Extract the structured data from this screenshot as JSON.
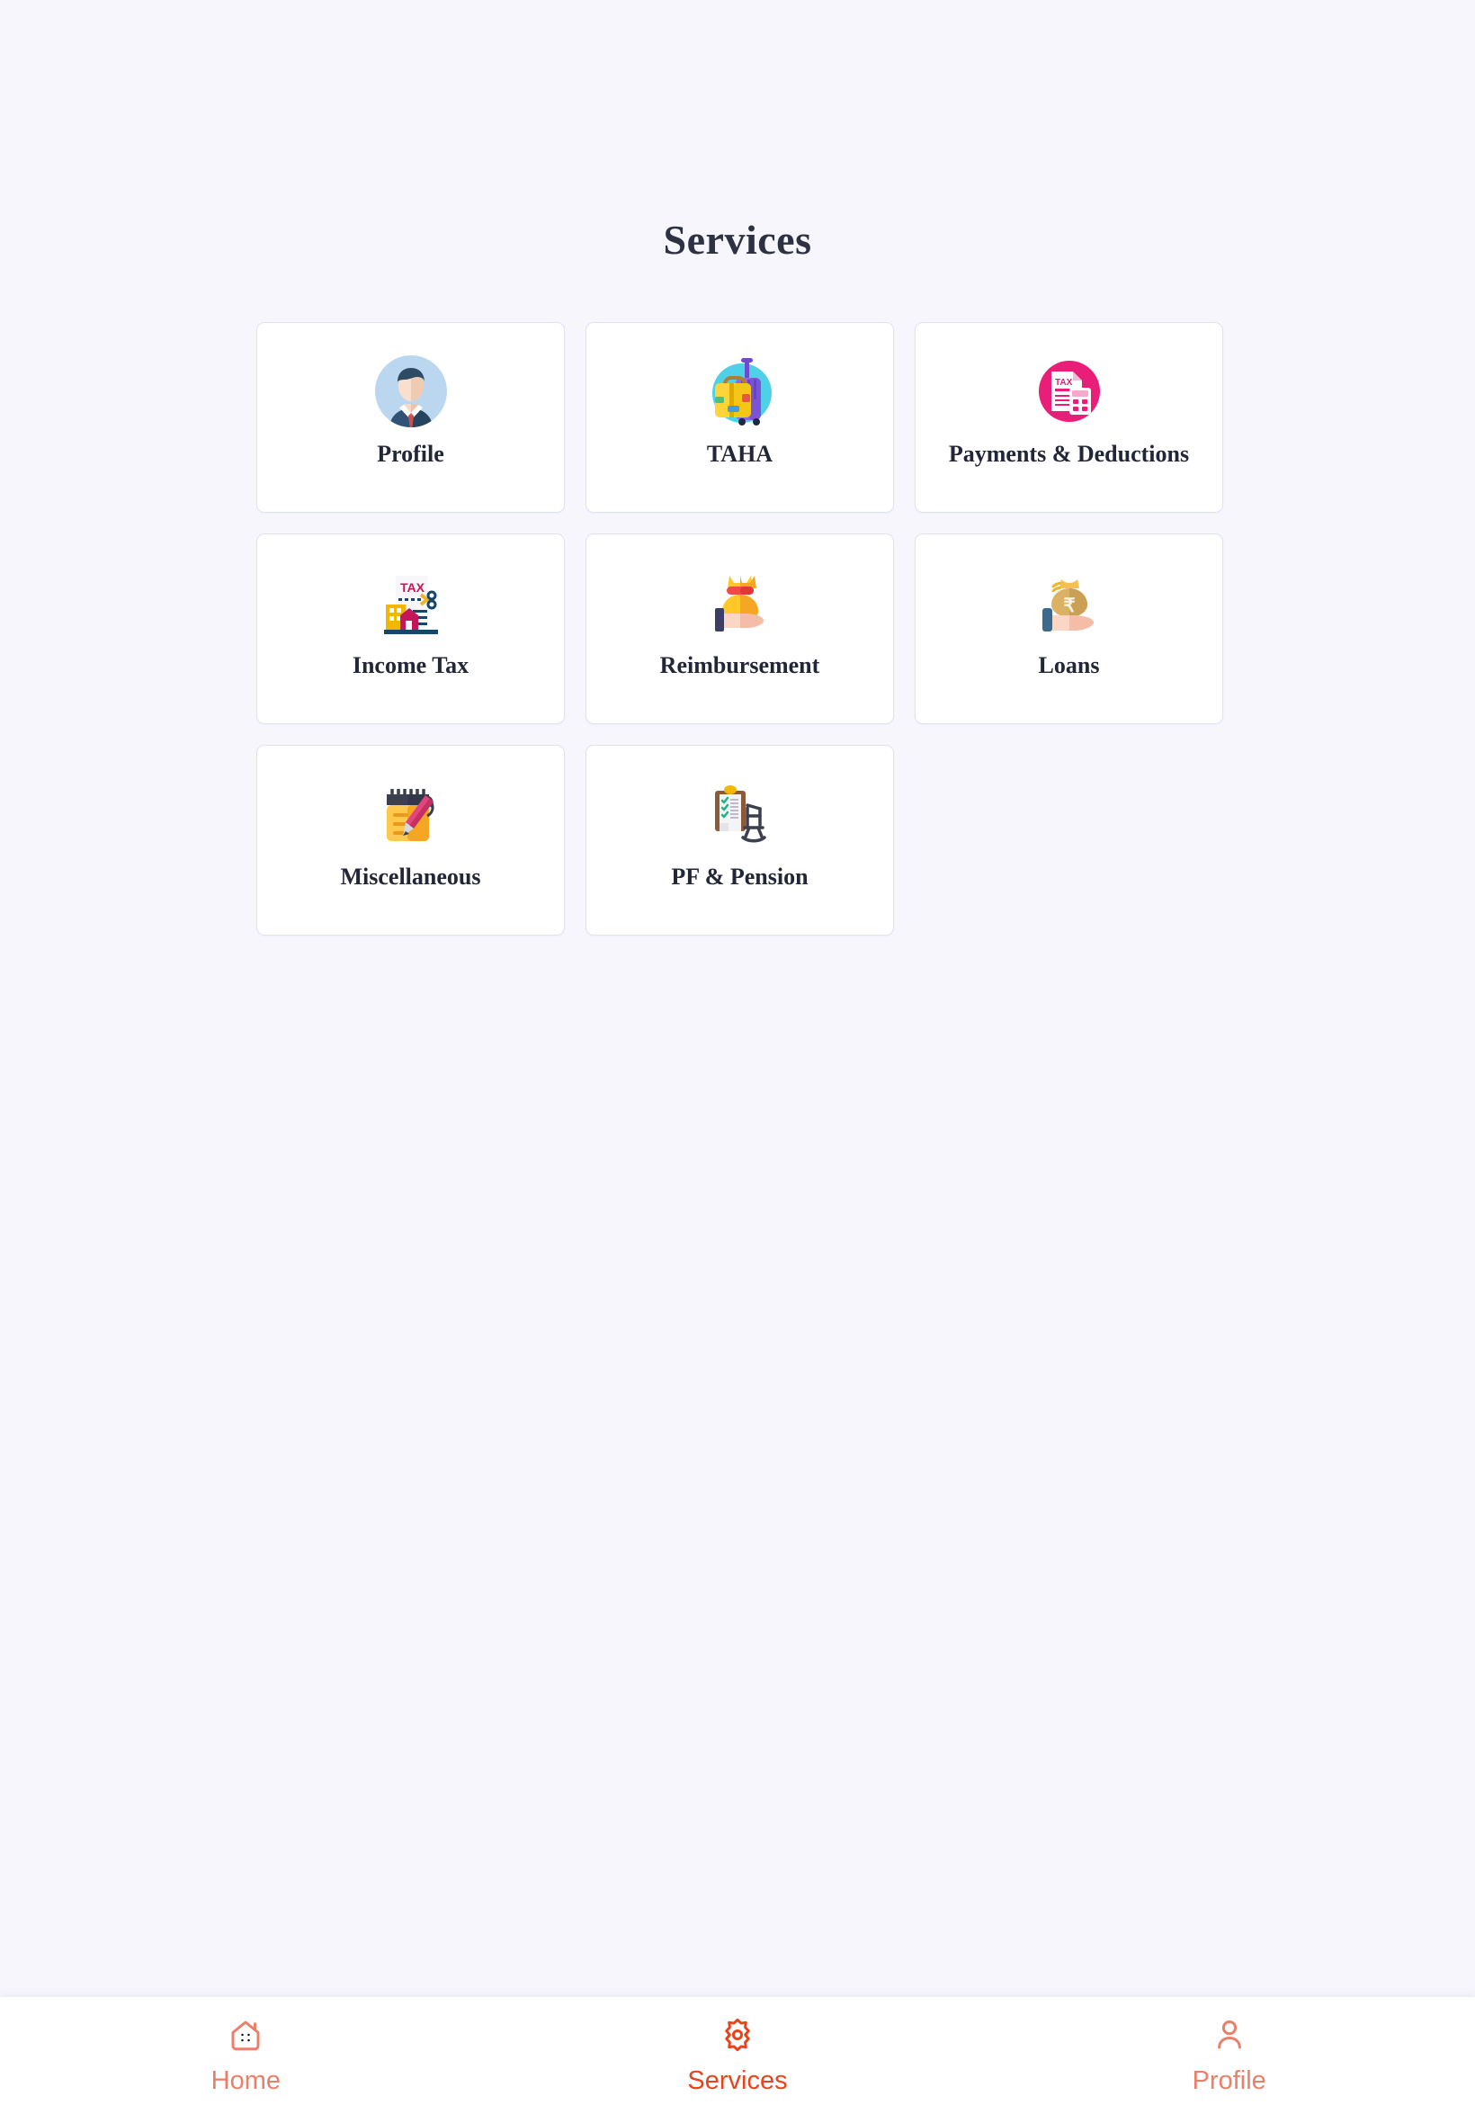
{
  "page": {
    "title": "Services",
    "background_color": "#f6f6fc"
  },
  "services": {
    "cards": [
      {
        "label": "Profile",
        "icon": "businessman-avatar-icon",
        "accent": "#bbd6ef"
      },
      {
        "label": "TAHA",
        "icon": "luggage-icon",
        "accent": "#4dd0e8"
      },
      {
        "label": "Payments & Deductions",
        "icon": "tax-calculator-icon",
        "accent": "#e91e78"
      },
      {
        "label": "Income Tax",
        "icon": "tax-document-scissors-icon",
        "accent": "#0a5078"
      },
      {
        "label": "Reimbursement",
        "icon": "hand-money-bag-icon",
        "accent": "#ffb020"
      },
      {
        "label": "Loans",
        "icon": "hand-rupee-bag-icon",
        "accent": "#dfae5c"
      },
      {
        "label": "Miscellaneous",
        "icon": "notepad-pen-icon",
        "accent": "#ffc043"
      },
      {
        "label": "PF & Pension",
        "icon": "clipboard-rockingchair-icon",
        "accent": "#8a5a3b"
      }
    ]
  },
  "bottom_nav": {
    "active_color": "#e8441c",
    "inactive_color": "#e8806a",
    "items": [
      {
        "label": "Home",
        "icon": "home-icon",
        "active": false
      },
      {
        "label": "Services",
        "icon": "gear-icon",
        "active": true
      },
      {
        "label": "Profile",
        "icon": "person-icon",
        "active": false
      }
    ]
  }
}
